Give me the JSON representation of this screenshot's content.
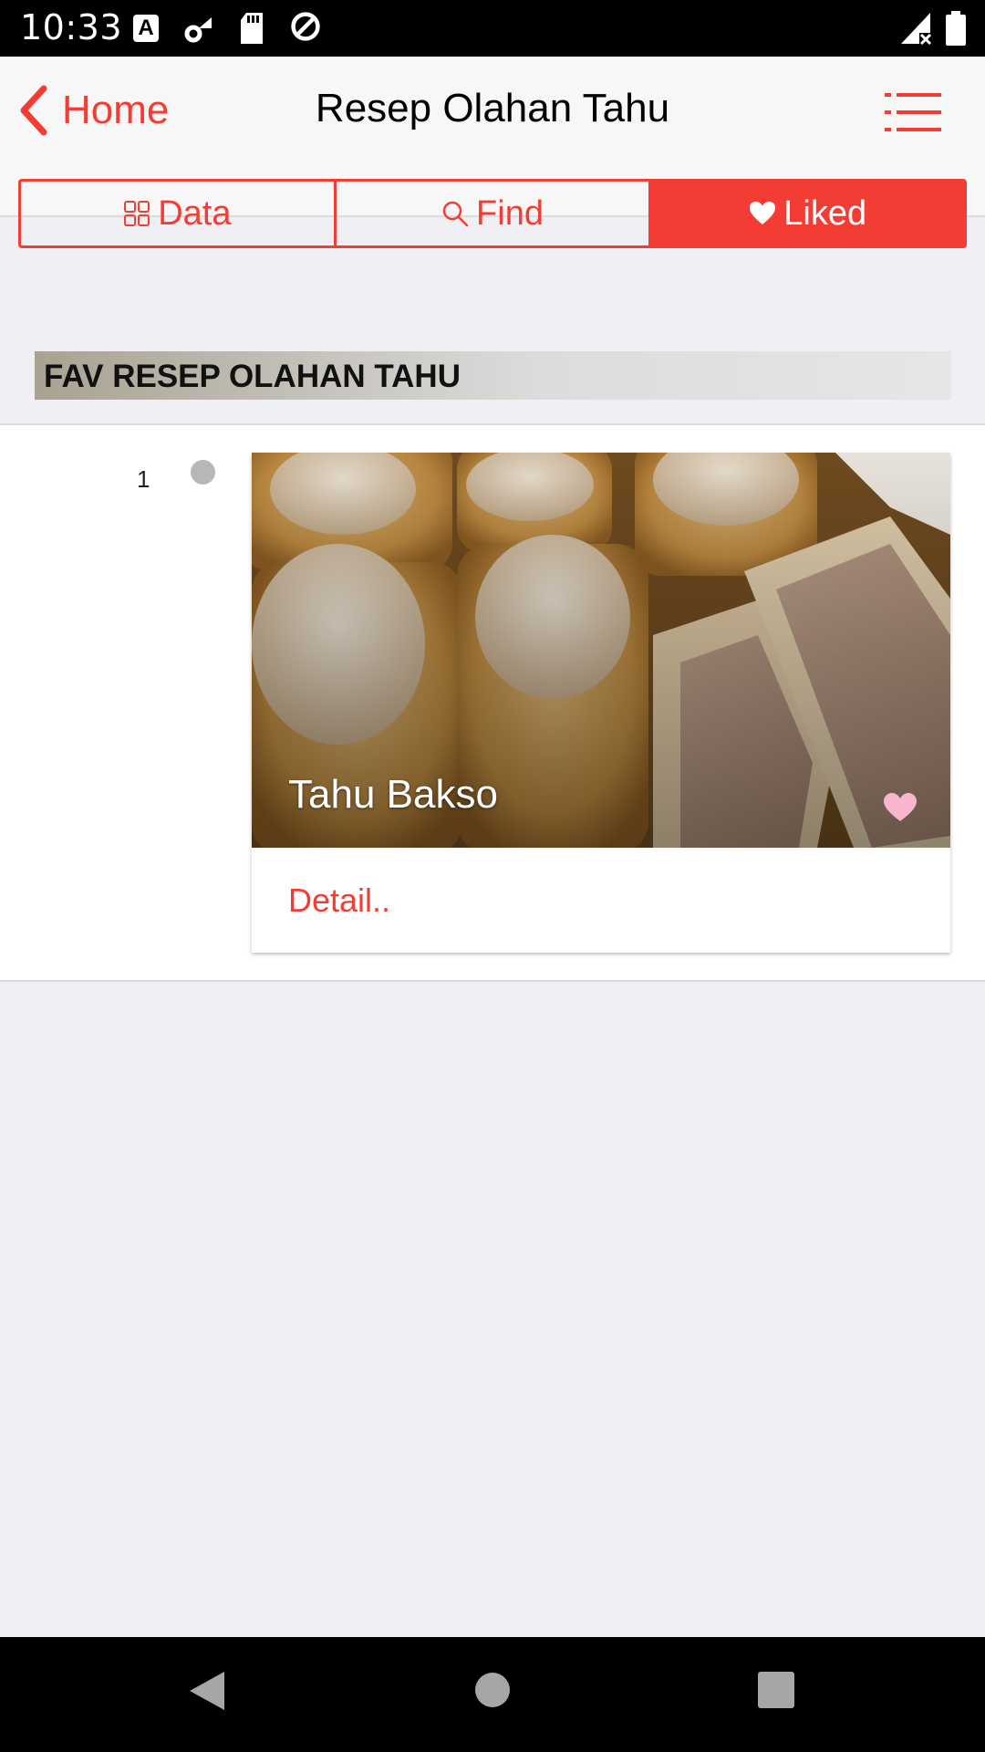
{
  "status_bar": {
    "time": "10:33",
    "icons": [
      "accessibility-a-icon",
      "cell-settings-icon",
      "sd-card-icon",
      "data-saver-icon",
      "signal-no-service-icon",
      "battery-icon"
    ]
  },
  "nav": {
    "back_label": "Home",
    "title": "Resep Olahan Tahu",
    "menu_icon": "list-menu-icon"
  },
  "tabs": [
    {
      "label": "Data",
      "icon": "grid-icon",
      "active": false
    },
    {
      "label": "Find",
      "icon": "search-icon",
      "active": false
    },
    {
      "label": "Liked",
      "icon": "heart-icon",
      "active": true
    }
  ],
  "section": {
    "title": "FAV RESEP OLAHAN TAHU"
  },
  "items": [
    {
      "number": "1",
      "caption": "Tahu Bakso",
      "link_label": "Detail..",
      "liked": true
    }
  ],
  "colors": {
    "accent": "#f33d34",
    "heart": "#f7b6cc",
    "background": "#efeff4"
  }
}
